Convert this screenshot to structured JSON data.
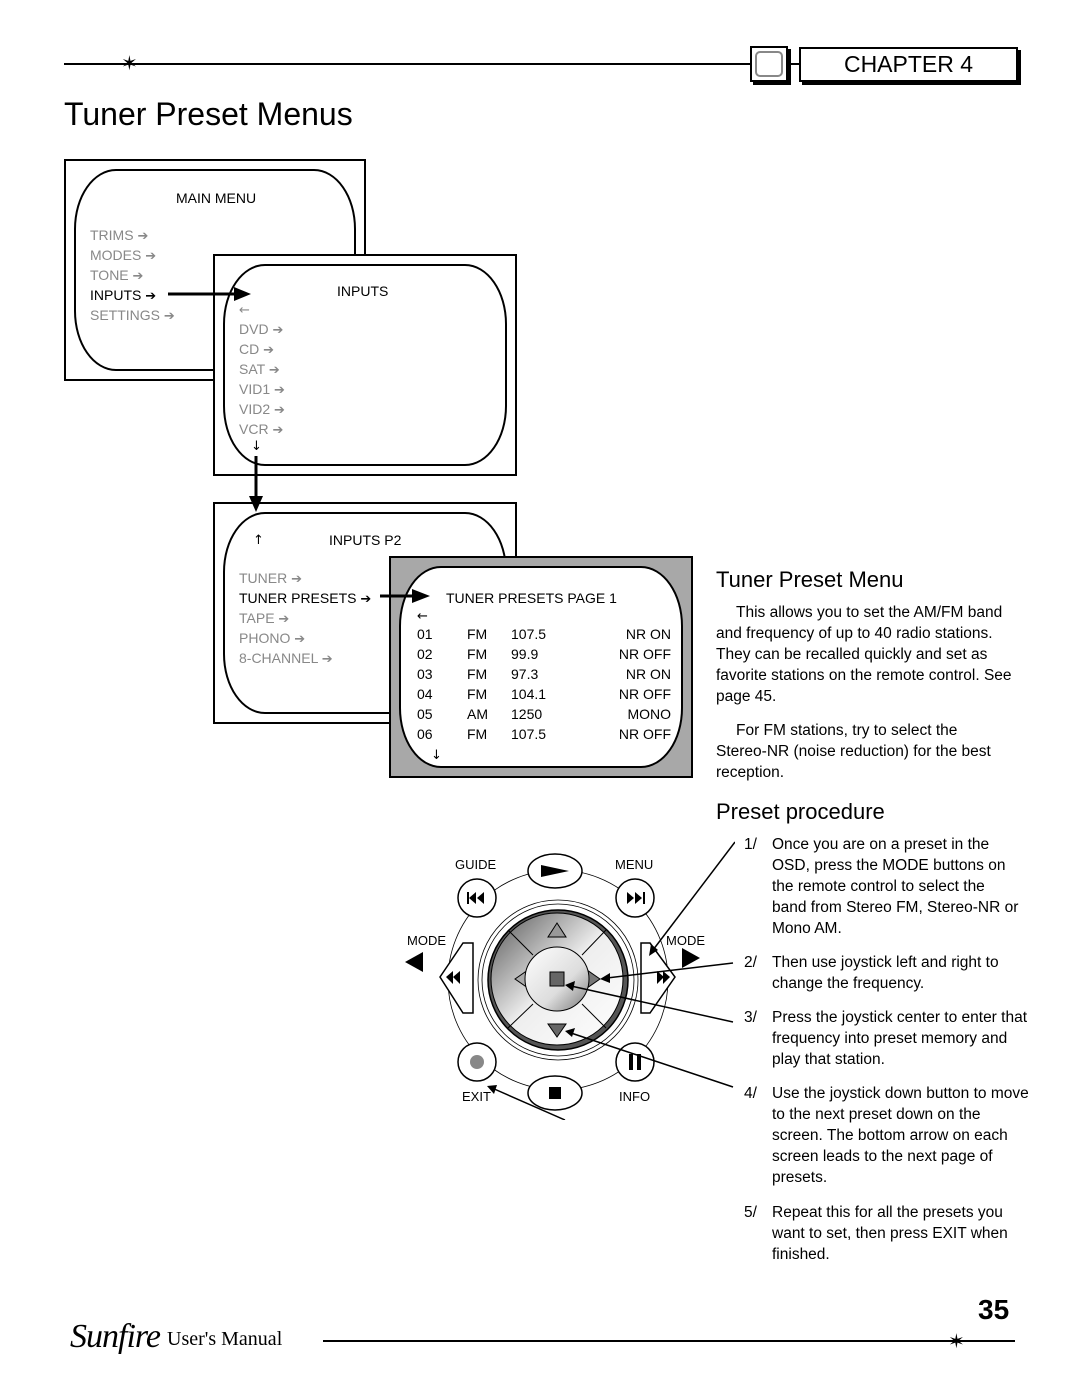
{
  "header": {
    "chapter_label": "CHAPTER 4",
    "page_title": "Tuner Preset Menus"
  },
  "osd": {
    "main_menu": {
      "title": "MAIN MENU",
      "items": [
        {
          "label": "TRIMS",
          "selected": false
        },
        {
          "label": "MODES",
          "selected": false
        },
        {
          "label": "TONE",
          "selected": false
        },
        {
          "label": "INPUTS",
          "selected": true
        },
        {
          "label": "SETTINGS",
          "selected": false
        }
      ]
    },
    "inputs": {
      "title": "INPUTS",
      "items": [
        {
          "label": "DVD"
        },
        {
          "label": "CD"
        },
        {
          "label": "SAT"
        },
        {
          "label": "VID1"
        },
        {
          "label": "VID2"
        },
        {
          "label": "VCR"
        }
      ]
    },
    "inputs_p2": {
      "title": "INPUTS P2",
      "items": [
        {
          "label": "TUNER",
          "selected": false
        },
        {
          "label": "TUNER PRESETS",
          "selected": true
        },
        {
          "label": "TAPE",
          "selected": false
        },
        {
          "label": "PHONO",
          "selected": false
        },
        {
          "label": "8-CHANNEL",
          "selected": false
        }
      ]
    },
    "tuner_presets": {
      "title": "TUNER PRESETS PAGE 1",
      "rows": [
        {
          "num": "01",
          "band": "FM",
          "freq": "107.5",
          "mode": "NR ON"
        },
        {
          "num": "02",
          "band": "FM",
          "freq": "99.9",
          "mode": "NR OFF"
        },
        {
          "num": "03",
          "band": "FM",
          "freq": "97.3",
          "mode": "NR ON"
        },
        {
          "num": "04",
          "band": "FM",
          "freq": "104.1",
          "mode": "NR OFF"
        },
        {
          "num": "05",
          "band": "AM",
          "freq": "1250",
          "mode": "MONO"
        },
        {
          "num": "06",
          "band": "FM",
          "freq": "107.5",
          "mode": "NR OFF"
        }
      ]
    },
    "arrow_right": "➔",
    "arrow_left": "←",
    "arrow_up": "↑",
    "arrow_down": "↓"
  },
  "tuner_preset_menu": {
    "heading": "Tuner Preset Menu",
    "para1": "This allows you to set the AM/FM band and frequency of up to 40 radio stations. They can be recalled quickly and set as favorite stations on the remote control. See page 45.",
    "para2": "For FM stations, try to select the Stereo-NR (noise reduction) for the best reception."
  },
  "preset_procedure": {
    "heading": "Preset procedure",
    "steps": [
      {
        "num": "1/",
        "text": "Once you are on a preset in the OSD, press the MODE buttons on the remote control to select the band from Stereo FM, Stereo-NR or Mono AM."
      },
      {
        "num": "2/",
        "text": "Then use joystick left and right to change the frequency."
      },
      {
        "num": "3/",
        "text": "Press the joystick center to enter that frequency into preset memory and play that station."
      },
      {
        "num": "4/",
        "text": "Use the joystick down button to move to the next preset down on the screen. The bottom arrow on each screen leads to the next page of presets."
      },
      {
        "num": "5/",
        "text": "Repeat this for all the presets you want to set, then press EXIT when finished."
      }
    ]
  },
  "remote": {
    "labels": {
      "guide": "GUIDE",
      "menu": "MENU",
      "mode_left": "MODE",
      "mode_right": "MODE",
      "exit": "EXIT",
      "info": "INFO"
    }
  },
  "footer": {
    "brand": "Sunfire",
    "manual": "User's Manual",
    "page_number": "35"
  }
}
